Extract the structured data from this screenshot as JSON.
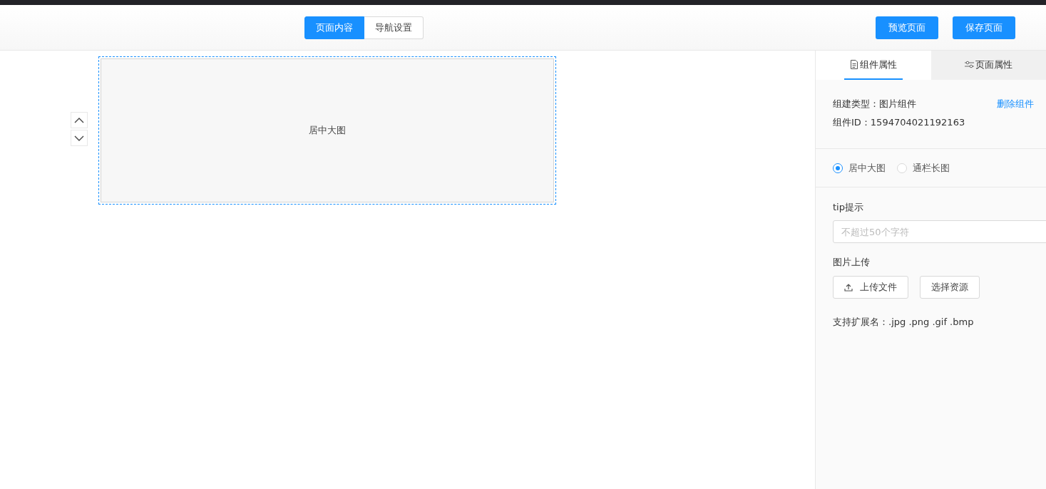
{
  "header": {
    "mode_tabs": [
      {
        "label": "页面内容",
        "selected": true
      },
      {
        "label": "导航设置",
        "selected": false
      }
    ],
    "buttons": [
      "预览页面",
      "保存页面"
    ]
  },
  "canvas": {
    "components": [
      {
        "label": "居中大图",
        "selected": true
      }
    ]
  },
  "panel": {
    "tabs": [
      {
        "label": "组件属性",
        "selected": true,
        "kind": "doc"
      },
      {
        "label": "页面属性",
        "selected": false,
        "kind": "sliders"
      }
    ],
    "type_line": "组建类型：图片组件",
    "delete_link": "删除组件",
    "id_line": "组件ID：1594704021192163",
    "layouts": [
      {
        "label": "居中大图",
        "selected": true
      },
      {
        "label": "通栏长图",
        "selected": false
      }
    ],
    "tip_label": "tip提示",
    "tip_field": {
      "placeholder": "不超过50个字符"
    },
    "upload_label": "图片上传",
    "upload_buttons": [
      {
        "label": "上传文件",
        "kind": "upload"
      },
      {
        "label": "选择资源",
        "kind": "plain"
      }
    ],
    "extensions": "支持扩展名：.jpg .png .gif .bmp"
  }
}
